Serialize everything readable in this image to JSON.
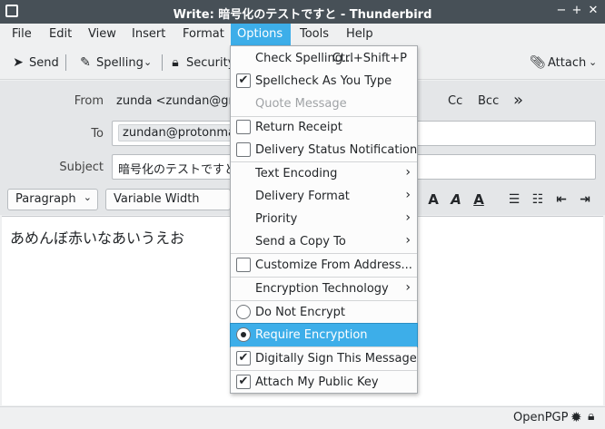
{
  "window": {
    "title": "Write: 暗号化のテストですと - Thunderbird",
    "minimize_label": "−",
    "maximize_label": "+",
    "close_label": "✕"
  },
  "menubar": {
    "items": [
      "File",
      "Edit",
      "View",
      "Insert",
      "Format",
      "Options",
      "Tools",
      "Help"
    ],
    "active": "Options"
  },
  "toolbar": {
    "send_label": "Send",
    "spelling_label": "Spelling",
    "security_label": "Security",
    "attach_label": "Attach"
  },
  "header": {
    "from_label": "From",
    "from_value": "zunda <zundan@gma",
    "cc_label": "Cc",
    "bcc_label": "Bcc",
    "more_label": "»",
    "to_label": "To",
    "to_value": "zundan@protonmail.",
    "subject_label": "Subject",
    "subject_value": "暗号化のテストですと"
  },
  "format_bar": {
    "paragraph_label": "Paragraph",
    "font_label": "Variable Width"
  },
  "editor": {
    "body_text": "あめんぼ赤いなあいうえお"
  },
  "status": {
    "openpgp_label": "OpenPGP"
  },
  "options_menu": {
    "check_spelling": "Check Spelling...",
    "check_spelling_shortcut": "Ctrl+Shift+P",
    "spellcheck_as_you_type": "Spellcheck As You Type",
    "quote_message": "Quote Message",
    "return_receipt": "Return Receipt",
    "delivery_status": "Delivery Status Notification",
    "text_encoding": "Text Encoding",
    "delivery_format": "Delivery Format",
    "priority": "Priority",
    "send_copy_to": "Send a Copy To",
    "customize_from": "Customize From Address...",
    "encryption_technology": "Encryption Technology",
    "do_not_encrypt": "Do Not Encrypt",
    "require_encryption": "Require Encryption",
    "digitally_sign": "Digitally Sign This Message",
    "attach_public_key": "Attach My Public Key"
  },
  "colors": {
    "titlebar": "#475057",
    "highlight": "#3daee9",
    "window_bg": "#eff0f1"
  }
}
